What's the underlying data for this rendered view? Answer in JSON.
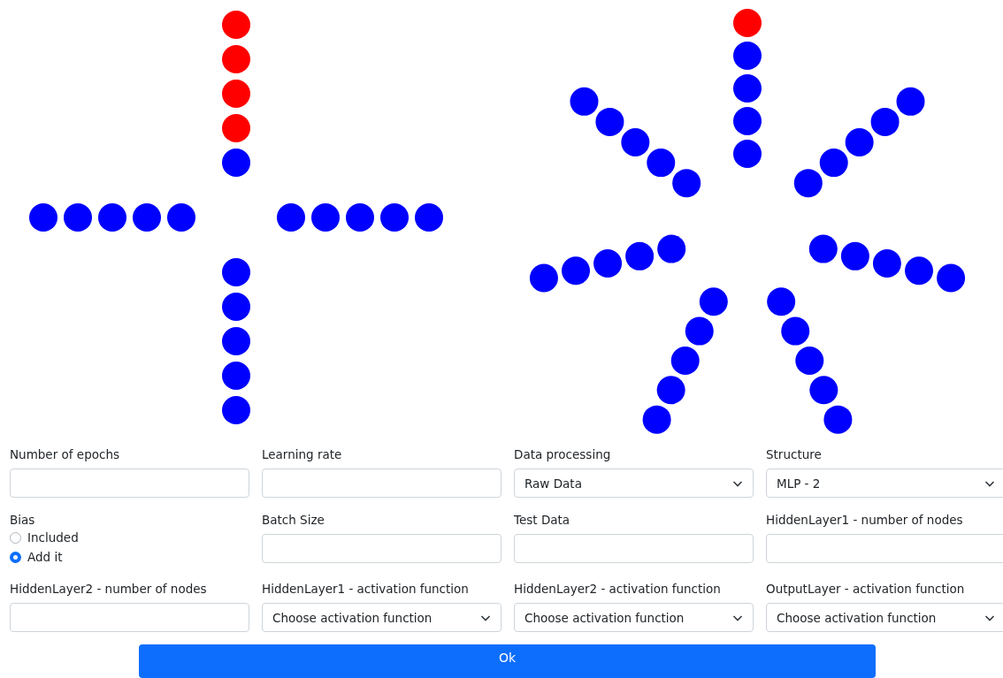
{
  "diagrams": [
    {
      "arms": [
        {
          "nodes": [
            {
              "color": "#0000ff"
            },
            {
              "color": "#ff0000"
            },
            {
              "color": "#ff0000"
            },
            {
              "color": "#ff0000"
            },
            {
              "color": "#ff0000"
            }
          ]
        },
        {
          "nodes": [
            {
              "color": "#0000ff"
            },
            {
              "color": "#0000ff"
            },
            {
              "color": "#0000ff"
            },
            {
              "color": "#0000ff"
            },
            {
              "color": "#0000ff"
            }
          ]
        },
        {
          "nodes": [
            {
              "color": "#0000ff"
            },
            {
              "color": "#0000ff"
            },
            {
              "color": "#0000ff"
            },
            {
              "color": "#0000ff"
            },
            {
              "color": "#0000ff"
            }
          ]
        },
        {
          "nodes": [
            {
              "color": "#0000ff"
            },
            {
              "color": "#0000ff"
            },
            {
              "color": "#0000ff"
            },
            {
              "color": "#0000ff"
            },
            {
              "color": "#0000ff"
            }
          ]
        }
      ]
    },
    {
      "arms": [
        {
          "nodes": [
            {
              "color": "#0000ff"
            },
            {
              "color": "#0000ff"
            },
            {
              "color": "#0000ff"
            },
            {
              "color": "#0000ff"
            },
            {
              "color": "#ff0000"
            }
          ]
        },
        {
          "nodes": [
            {
              "color": "#0000ff"
            },
            {
              "color": "#0000ff"
            },
            {
              "color": "#0000ff"
            },
            {
              "color": "#0000ff"
            },
            {
              "color": "#0000ff"
            }
          ]
        },
        {
          "nodes": [
            {
              "color": "#0000ff"
            },
            {
              "color": "#0000ff"
            },
            {
              "color": "#0000ff"
            },
            {
              "color": "#0000ff"
            },
            {
              "color": "#0000ff"
            }
          ]
        },
        {
          "nodes": [
            {
              "color": "#0000ff"
            },
            {
              "color": "#0000ff"
            },
            {
              "color": "#0000ff"
            },
            {
              "color": "#0000ff"
            },
            {
              "color": "#0000ff"
            }
          ]
        },
        {
          "nodes": [
            {
              "color": "#0000ff"
            },
            {
              "color": "#0000ff"
            },
            {
              "color": "#0000ff"
            },
            {
              "color": "#0000ff"
            },
            {
              "color": "#0000ff"
            }
          ]
        },
        {
          "nodes": [
            {
              "color": "#0000ff"
            },
            {
              "color": "#0000ff"
            },
            {
              "color": "#0000ff"
            },
            {
              "color": "#0000ff"
            },
            {
              "color": "#0000ff"
            }
          ]
        },
        {
          "nodes": [
            {
              "color": "#0000ff"
            },
            {
              "color": "#0000ff"
            },
            {
              "color": "#0000ff"
            },
            {
              "color": "#0000ff"
            },
            {
              "color": "#0000ff"
            }
          ]
        }
      ]
    }
  ],
  "fields": [
    {
      "kind": "text",
      "label": "Number of epochs"
    },
    {
      "kind": "text",
      "label": "Learning rate"
    },
    {
      "kind": "select",
      "label": "Data processing",
      "value": "Raw Data"
    },
    {
      "kind": "select",
      "label": "Structure",
      "value": "MLP - 2"
    },
    {
      "kind": "radio",
      "label": "Bias",
      "options": [
        {
          "label": "Included",
          "selected": false
        },
        {
          "label": "Add it",
          "selected": true
        }
      ]
    },
    {
      "kind": "text",
      "label": "Batch Size"
    },
    {
      "kind": "text",
      "label": "Test Data"
    },
    {
      "kind": "text",
      "label": "HiddenLayer1 - number of nodes"
    },
    {
      "kind": "text",
      "label": "HiddenLayer2 - number of nodes"
    },
    {
      "kind": "select",
      "label": "HiddenLayer1 - activation function",
      "value": "Choose activation function"
    },
    {
      "kind": "select",
      "label": "HiddenLayer2 - activation function",
      "value": "Choose activation function"
    },
    {
      "kind": "select",
      "label": "OutputLayer - activation function",
      "value": "Choose activation function"
    }
  ],
  "submit": {
    "label": "Ok"
  }
}
